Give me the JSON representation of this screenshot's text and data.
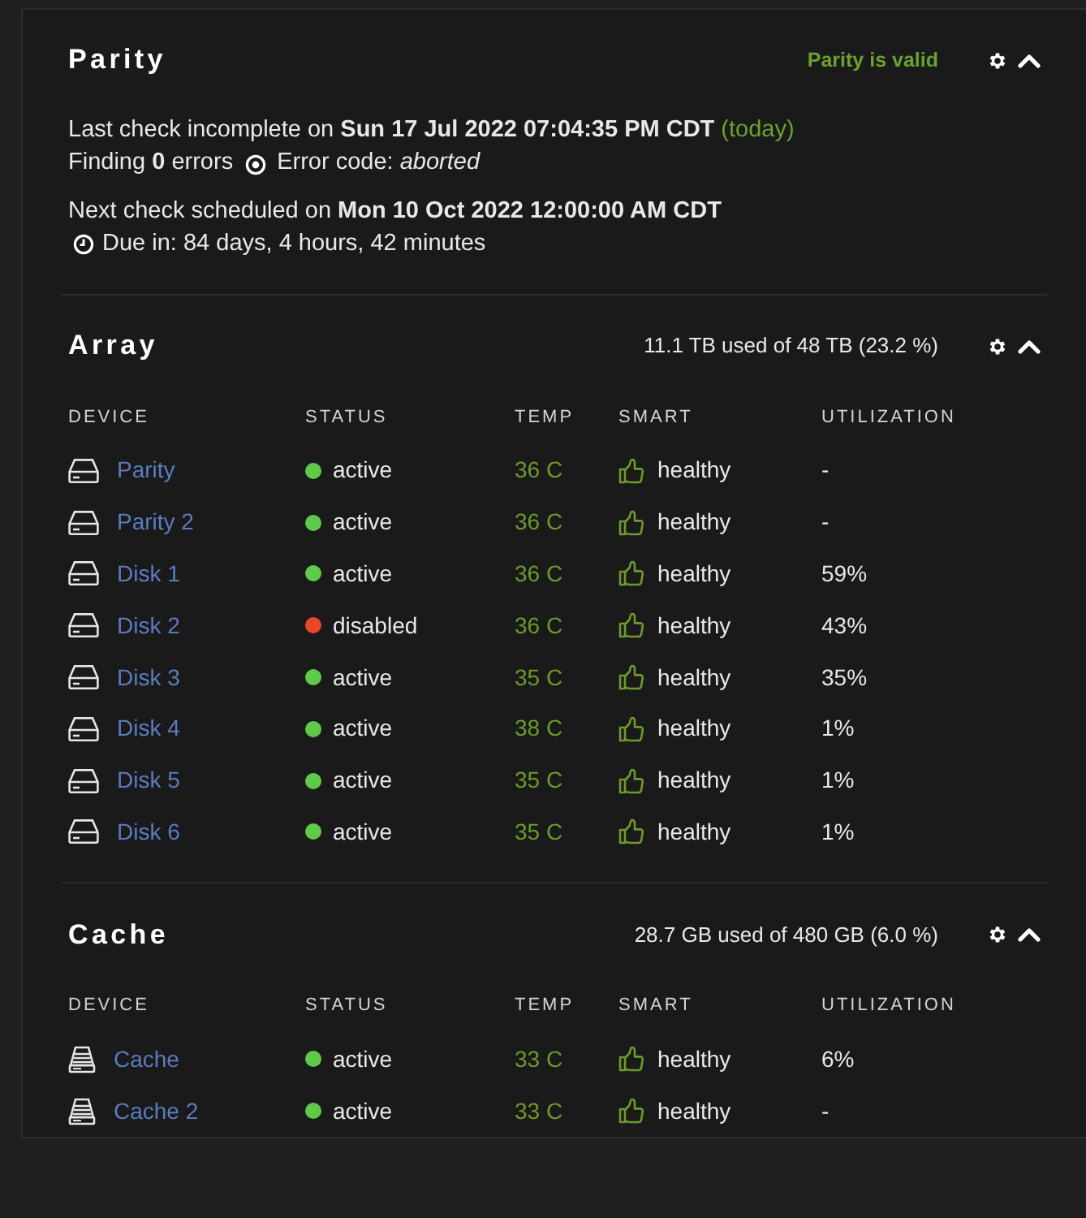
{
  "parity": {
    "title": "Parity",
    "status": "Parity is valid",
    "last_check": "Last check incomplete on **Sun 17 Jul 2022 07:04:35 PM CDT**",
    "last_check_note": "(today)",
    "findings": "Finding **0** errors",
    "error_code": "Error code: *aborted*",
    "next_check": "Next check scheduled on **Mon 10 Oct 2022 12:00:00 AM CDT**",
    "due": "Due in: 84 days, 4 hours, 42 minutes"
  },
  "array": {
    "title": "Array",
    "usage": "11.1 TB used of 48 TB (23.2 %)",
    "columns": [
      "DEVICE",
      "STATUS",
      "TEMP",
      "SMART",
      "UTILIZATION"
    ],
    "rows": [
      {
        "device": "Parity",
        "status": "active",
        "color": "#5fc94a",
        "temp": "36 C",
        "smart": "healthy",
        "utilization": "-"
      },
      {
        "device": "Parity 2",
        "status": "active",
        "color": "#5fc94a",
        "temp": "36 C",
        "smart": "healthy",
        "utilization": "-"
      },
      {
        "device": "Disk 1",
        "status": "active",
        "color": "#5fc94a",
        "temp": "36 C",
        "smart": "healthy",
        "utilization": "59%"
      },
      {
        "device": "Disk 2",
        "status": "disabled",
        "color": "#e8472a",
        "temp": "36 C",
        "smart": "healthy",
        "utilization": "43%"
      },
      {
        "device": "Disk 3",
        "status": "active",
        "color": "#5fc94a",
        "temp": "35 C",
        "smart": "healthy",
        "utilization": "35%"
      },
      {
        "device": "Disk 4",
        "status": "active",
        "color": "#5fc94a",
        "temp": "38 C",
        "smart": "healthy",
        "utilization": "1%"
      },
      {
        "device": "Disk 5",
        "status": "active",
        "color": "#5fc94a",
        "temp": "35 C",
        "smart": "healthy",
        "utilization": "1%"
      },
      {
        "device": "Disk 6",
        "status": "active",
        "color": "#5fc94a",
        "temp": "35 C",
        "smart": "healthy",
        "utilization": "1%"
      }
    ]
  },
  "cache": {
    "title": "Cache",
    "usage": "28.7 GB used of 480 GB (6.0 %)",
    "columns": [
      "DEVICE",
      "STATUS",
      "TEMP",
      "SMART",
      "UTILIZATION"
    ],
    "rows": [
      {
        "device": "Cache",
        "status": "active",
        "color": "#5fc94a",
        "temp": "33 C",
        "smart": "healthy",
        "utilization": "6%"
      },
      {
        "device": "Cache 2",
        "status": "active",
        "color": "#5fc94a",
        "temp": "33 C",
        "smart": "healthy",
        "utilization": "-"
      }
    ]
  }
}
